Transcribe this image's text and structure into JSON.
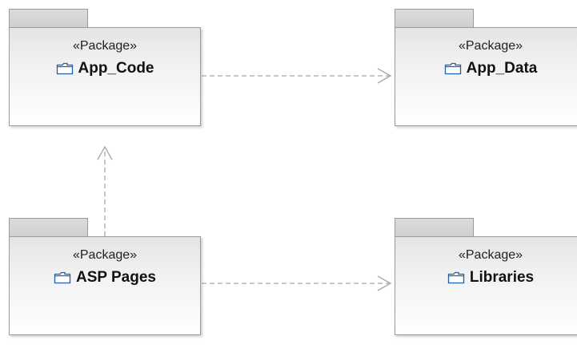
{
  "packages": [
    {
      "id": "app-code",
      "stereotype": "«Package»",
      "name": "App_Code",
      "icon": "folder-icon"
    },
    {
      "id": "app-data",
      "stereotype": "«Package»",
      "name": "App_Data",
      "icon": "folder-icon"
    },
    {
      "id": "asp-pages",
      "stereotype": "«Package»",
      "name": "ASP Pages",
      "icon": "folder-icon"
    },
    {
      "id": "libraries",
      "stereotype": "«Package»",
      "name": "Libraries",
      "icon": "folder-icon"
    }
  ],
  "dependencies": [
    {
      "from": "App_Code",
      "to": "App_Data",
      "style": "dashed",
      "arrow": "open"
    },
    {
      "from": "ASP Pages",
      "to": "App_Code",
      "style": "dashed",
      "arrow": "open"
    },
    {
      "from": "ASP Pages",
      "to": "Libraries",
      "style": "dashed",
      "arrow": "open"
    }
  ],
  "colors": {
    "line": "#a8a8a8",
    "border": "#9a9a9a",
    "tab": "#d4d4d4",
    "icon": "#1f5fb0"
  }
}
